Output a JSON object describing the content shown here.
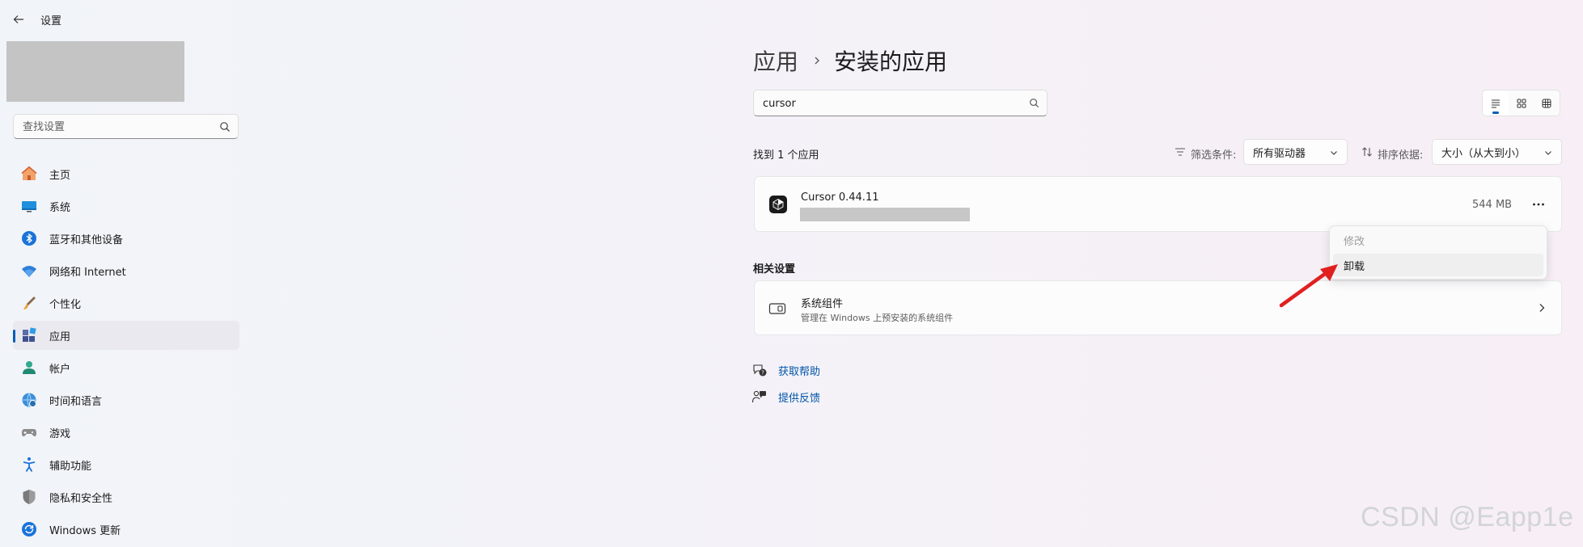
{
  "window": {
    "title": "设置"
  },
  "sidebar": {
    "search_placeholder": "查找设置",
    "items": [
      {
        "label": "主页",
        "icon": "home-icon"
      },
      {
        "label": "系统",
        "icon": "monitor-icon"
      },
      {
        "label": "蓝牙和其他设备",
        "icon": "bluetooth-icon"
      },
      {
        "label": "网络和 Internet",
        "icon": "wifi-icon"
      },
      {
        "label": "个性化",
        "icon": "brush-icon"
      },
      {
        "label": "应用",
        "icon": "apps-icon",
        "active": true
      },
      {
        "label": "帐户",
        "icon": "account-icon"
      },
      {
        "label": "时间和语言",
        "icon": "globe-clock-icon"
      },
      {
        "label": "游戏",
        "icon": "gamepad-icon"
      },
      {
        "label": "辅助功能",
        "icon": "accessibility-icon"
      },
      {
        "label": "隐私和安全性",
        "icon": "shield-icon"
      },
      {
        "label": "Windows 更新",
        "icon": "update-icon"
      }
    ]
  },
  "header": {
    "breadcrumb_parent": "应用",
    "breadcrumb_current": "安装的应用"
  },
  "search": {
    "value": "cursor"
  },
  "results": {
    "found_text": "找到 1 个应用",
    "filter_label": "筛选条件:",
    "filter_value": "所有驱动器",
    "sort_label": "排序依据:",
    "sort_value": "大小（从大到小）"
  },
  "app": {
    "name": "Cursor 0.44.11",
    "size": "544 MB"
  },
  "context_menu": {
    "modify": "修改",
    "uninstall": "卸载"
  },
  "related": {
    "title": "相关设置",
    "system_components_title": "系统组件",
    "system_components_desc": "管理在 Windows 上预安装的系统组件"
  },
  "links": {
    "help": "获取帮助",
    "feedback": "提供反馈"
  },
  "watermark": "CSDN @Eapp1e",
  "colors": {
    "accent": "#005fb8",
    "link": "#0055aa",
    "annotation_arrow": "#e02020"
  }
}
